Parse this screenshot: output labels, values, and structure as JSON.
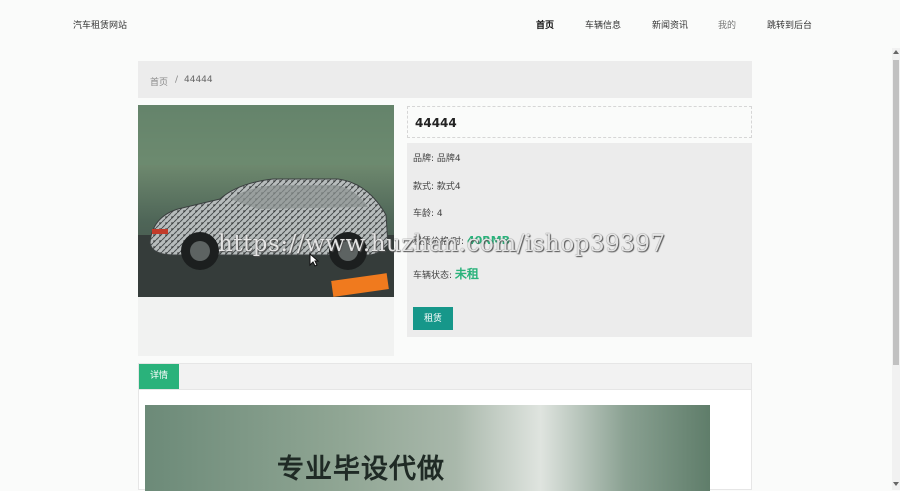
{
  "header": {
    "brand": "汽车租赁网站",
    "nav": [
      {
        "label": "首页",
        "active": true
      },
      {
        "label": "车辆信息",
        "active": false
      },
      {
        "label": "新闻资讯",
        "active": false
      },
      {
        "label": "我的",
        "active": false
      },
      {
        "label": "跳转到后台",
        "active": false
      }
    ]
  },
  "breadcrumb": {
    "home": "首页",
    "separator": "/",
    "current": "44444"
  },
  "car": {
    "title": "44444",
    "brand_label": "品牌:",
    "brand_value": "品牌4",
    "style_label": "款式:",
    "style_value": "款式4",
    "age_label": "车龄:",
    "age_value": "4",
    "price_label": "租赁价格/时:",
    "price_value": "40RMB",
    "status_label": "车辆状态:",
    "status_value": "未租",
    "rent_button": "租赁"
  },
  "detail": {
    "tab_label": "详情",
    "banner_text": "专业毕设代做"
  },
  "overlay": {
    "watermark": "https://www.huzhan.com/ishop39397"
  },
  "colors": {
    "accent_green": "#2ab27b",
    "button_teal": "#16978a"
  }
}
